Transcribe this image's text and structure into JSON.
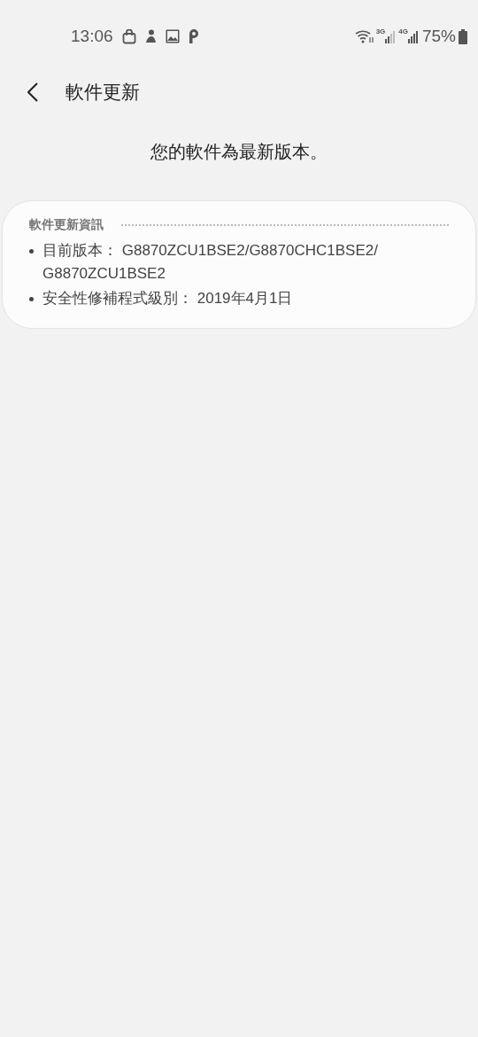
{
  "status_bar": {
    "time": "13:06",
    "network_1": "3G",
    "network_2": "4G",
    "battery": "75%"
  },
  "header": {
    "title": "軟件更新"
  },
  "message": "您的軟件為最新版本。",
  "info_card": {
    "title": "軟件更新資訊",
    "items": [
      {
        "label": "目前版本：",
        "value": "G8870ZCU1BSE2/G8870CHC1BSE2/G8870ZCU1BSE2"
      },
      {
        "label": "安全性修補程式級別：",
        "value": "2019年4月1日"
      }
    ]
  }
}
